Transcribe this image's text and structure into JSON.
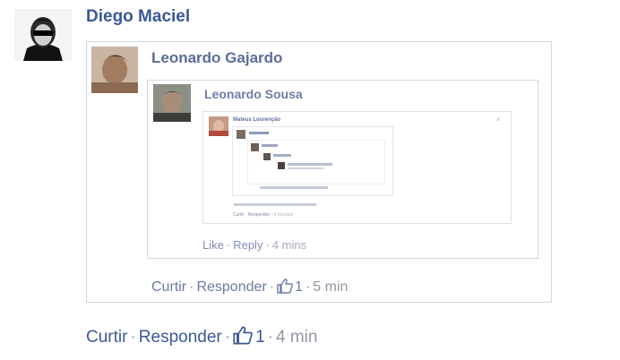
{
  "comment1": {
    "author": "Diego Maciel",
    "actions": {
      "like": "Curtir",
      "reply": "Responder",
      "like_count": "1",
      "time": "4 min"
    }
  },
  "comment2": {
    "author": "Leonardo Gajardo",
    "actions": {
      "like": "Curtir",
      "reply": "Responder",
      "like_count": "1",
      "time": "5 min"
    }
  },
  "comment3": {
    "author": "Leonardo Sousa",
    "actions": {
      "like": "Like",
      "reply": "Reply",
      "time": "4 mins"
    }
  },
  "comment4": {
    "author": "Mateus Lourenção",
    "actions": {
      "like": "Curtir",
      "reply": "Responder",
      "time": "4 minutos"
    }
  },
  "colors": {
    "link": "#3b5998",
    "muted": "#9197a3",
    "border": "#d3d6db"
  },
  "icons": [
    "thumbs-up-icon",
    "close-icon"
  ]
}
